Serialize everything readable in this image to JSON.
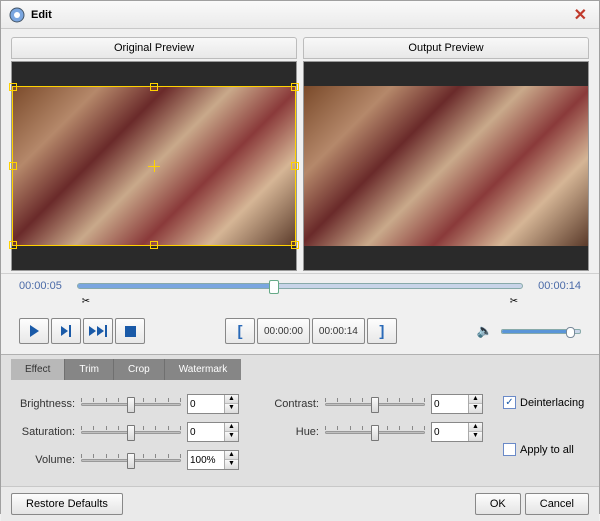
{
  "window": {
    "title": "Edit"
  },
  "preview": {
    "original": "Original Preview",
    "output": "Output Preview"
  },
  "timeline": {
    "start_time": "00:00:05",
    "end_time": "00:00:14",
    "progress_pct": 44
  },
  "controls": {
    "in_time": "00:00:00",
    "out_time": "00:00:14"
  },
  "tabs": {
    "effect": "Effect",
    "trim": "Trim",
    "crop": "Crop",
    "watermark": "Watermark",
    "active": "effect"
  },
  "effect": {
    "brightness": {
      "label": "Brightness:",
      "value": "0",
      "pct": 50
    },
    "saturation": {
      "label": "Saturation:",
      "value": "0",
      "pct": 50
    },
    "volume": {
      "label": "Volume:",
      "value": "100%",
      "pct": 50
    },
    "contrast": {
      "label": "Contrast:",
      "value": "0",
      "pct": 50
    },
    "hue": {
      "label": "Hue:",
      "value": "0",
      "pct": 50
    },
    "deinterlacing": {
      "label": "Deinterlacing",
      "checked": true
    },
    "apply_all": {
      "label": "Apply to all",
      "checked": false
    }
  },
  "footer": {
    "restore": "Restore Defaults",
    "ok": "OK",
    "cancel": "Cancel"
  }
}
